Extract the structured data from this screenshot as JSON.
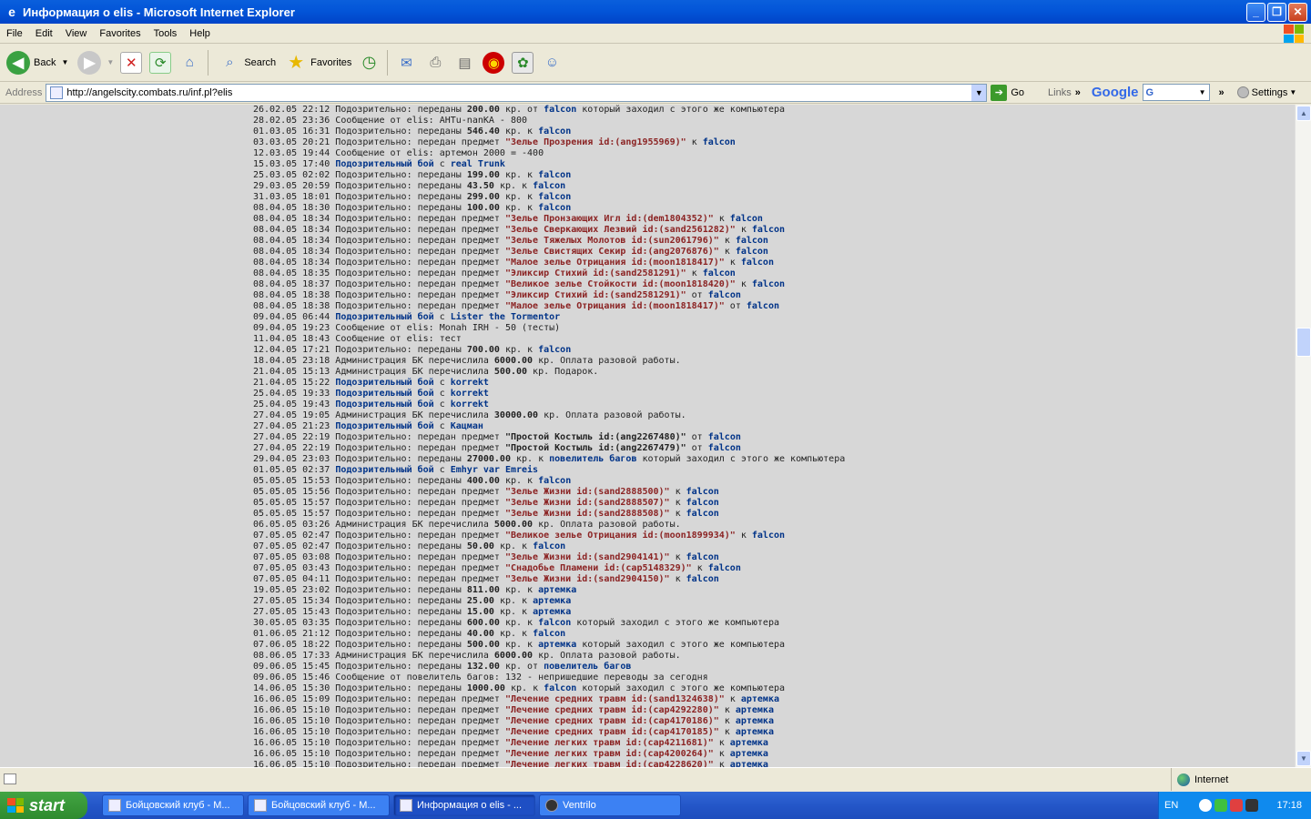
{
  "window": {
    "title": "Информация о elis - Microsoft Internet Explorer",
    "minimize": "_",
    "maximize": "❐",
    "close": "✕"
  },
  "menu": [
    "File",
    "Edit",
    "View",
    "Favorites",
    "Tools",
    "Help"
  ],
  "toolbar": {
    "back": "Back",
    "search": "Search",
    "favorites": "Favorites"
  },
  "address": {
    "label": "Address",
    "url": "http://angelscity.combats.ru/inf.pl?elis",
    "go": "Go",
    "links": "Links",
    "google": "Google",
    "google_select": "G",
    "settings": "Settings"
  },
  "log": [
    [
      [
        "26.02.05 22:12 Подозрительно: переданы ",
        ""
      ],
      [
        "200.00",
        "b"
      ],
      [
        " кр. от ",
        ""
      ],
      [
        "falcon",
        "n"
      ],
      [
        " который заходил с этого же компьютера",
        ""
      ]
    ],
    [
      [
        "28.02.05 23:36 Сообщение от elis: AHTu-nanKA - 800",
        ""
      ]
    ],
    [
      [
        "01.03.05 16:31 Подозрительно: переданы ",
        ""
      ],
      [
        "546.40",
        "b"
      ],
      [
        " кр. к ",
        ""
      ],
      [
        "falcon",
        "n"
      ]
    ],
    [
      [
        "03.03.05 20:21 Подозрительно: передан предмет ",
        ""
      ],
      [
        "\"Зелье Прозрения id:(ang1955969)\"",
        "i"
      ],
      [
        " к ",
        ""
      ],
      [
        "falcon",
        "n"
      ]
    ],
    [
      [
        "12.03.05 19:44 Сообщение от elis: артемон 2000 = -400",
        ""
      ]
    ],
    [
      [
        "15.03.05 17:40 ",
        ""
      ],
      [
        "Подозрительный бой",
        "n"
      ],
      [
        " с ",
        ""
      ],
      [
        "real Trunk",
        "n"
      ]
    ],
    [
      [
        "25.03.05 02:02 Подозрительно: переданы ",
        ""
      ],
      [
        "199.00",
        "b"
      ],
      [
        " кр. к ",
        ""
      ],
      [
        "falcon",
        "n"
      ]
    ],
    [
      [
        "29.03.05 20:59 Подозрительно: переданы ",
        ""
      ],
      [
        "43.50",
        "b"
      ],
      [
        " кр. к ",
        ""
      ],
      [
        "falcon",
        "n"
      ]
    ],
    [
      [
        "31.03.05 18:01 Подозрительно: переданы ",
        ""
      ],
      [
        "299.00",
        "b"
      ],
      [
        " кр. к ",
        ""
      ],
      [
        "falcon",
        "n"
      ]
    ],
    [
      [
        "08.04.05 18:30 Подозрительно: переданы ",
        ""
      ],
      [
        "100.00",
        "b"
      ],
      [
        " кр. к ",
        ""
      ],
      [
        "falcon",
        "n"
      ]
    ],
    [
      [
        "08.04.05 18:34 Подозрительно: передан предмет ",
        ""
      ],
      [
        "\"Зелье Пронзающих Игл id:(dem1804352)\"",
        "i"
      ],
      [
        " к ",
        ""
      ],
      [
        "falcon",
        "n"
      ]
    ],
    [
      [
        "08.04.05 18:34 Подозрительно: передан предмет ",
        ""
      ],
      [
        "\"Зелье Сверкающих Лезвий id:(sand2561282)\"",
        "i"
      ],
      [
        " к ",
        ""
      ],
      [
        "falcon",
        "n"
      ]
    ],
    [
      [
        "08.04.05 18:34 Подозрительно: передан предмет ",
        ""
      ],
      [
        "\"Зелье Тяжелых Молотов id:(sun2061796)\"",
        "i"
      ],
      [
        " к ",
        ""
      ],
      [
        "falcon",
        "n"
      ]
    ],
    [
      [
        "08.04.05 18:34 Подозрительно: передан предмет ",
        ""
      ],
      [
        "\"Зелье Свистящих Секир id:(ang2076876)\"",
        "i"
      ],
      [
        " к ",
        ""
      ],
      [
        "falcon",
        "n"
      ]
    ],
    [
      [
        "08.04.05 18:34 Подозрительно: передан предмет ",
        ""
      ],
      [
        "\"Малое зелье Отрицания id:(moon1818417)\"",
        "i"
      ],
      [
        " к ",
        ""
      ],
      [
        "falcon",
        "n"
      ]
    ],
    [
      [
        "08.04.05 18:35 Подозрительно: передан предмет ",
        ""
      ],
      [
        "\"Эликсир Стихий id:(sand2581291)\"",
        "i"
      ],
      [
        " к ",
        ""
      ],
      [
        "falcon",
        "n"
      ]
    ],
    [
      [
        "08.04.05 18:37 Подозрительно: передан предмет ",
        ""
      ],
      [
        "\"Великое зелье Стойкости id:(moon1818420)\"",
        "i"
      ],
      [
        " к ",
        ""
      ],
      [
        "falcon",
        "n"
      ]
    ],
    [
      [
        "08.04.05 18:38 Подозрительно: передан предмет ",
        ""
      ],
      [
        "\"Эликсир Стихий id:(sand2581291)\"",
        "i"
      ],
      [
        " от ",
        ""
      ],
      [
        "falcon",
        "n"
      ]
    ],
    [
      [
        "08.04.05 18:38 Подозрительно: передан предмет ",
        ""
      ],
      [
        "\"Малое зелье Отрицания id:(moon1818417)\"",
        "i"
      ],
      [
        " от ",
        ""
      ],
      [
        "falcon",
        "n"
      ]
    ],
    [
      [
        "09.04.05 06:44 ",
        ""
      ],
      [
        "Подозрительный бой",
        "n"
      ],
      [
        " с ",
        ""
      ],
      [
        "Lister the Tormentor",
        "n"
      ]
    ],
    [
      [
        "09.04.05 19:23 Сообщение от elis: Monah IRH - 50 (тесты)",
        ""
      ]
    ],
    [
      [
        "11.04.05 18:43 Сообщение от elis: тест",
        ""
      ]
    ],
    [
      [
        "12.04.05 17:21 Подозрительно: переданы ",
        ""
      ],
      [
        "700.00",
        "b"
      ],
      [
        " кр. к ",
        ""
      ],
      [
        "falcon",
        "n"
      ]
    ],
    [
      [
        "18.04.05 23:18 Администрация БК перечислила ",
        ""
      ],
      [
        "6000.00",
        "b"
      ],
      [
        " кр. Оплата разовой работы.",
        ""
      ]
    ],
    [
      [
        "21.04.05 15:13 Администрация БК перечислила ",
        ""
      ],
      [
        "500.00",
        "b"
      ],
      [
        " кр. Подарок.",
        ""
      ]
    ],
    [
      [
        "21.04.05 15:22 ",
        ""
      ],
      [
        "Подозрительный бой",
        "n"
      ],
      [
        " с ",
        ""
      ],
      [
        "korrekt",
        "n"
      ]
    ],
    [
      [
        "25.04.05 19:33 ",
        ""
      ],
      [
        "Подозрительный бой",
        "n"
      ],
      [
        " с ",
        ""
      ],
      [
        "korrekt",
        "n"
      ]
    ],
    [
      [
        "25.04.05 19:43 ",
        ""
      ],
      [
        "Подозрительный бой",
        "n"
      ],
      [
        " с ",
        ""
      ],
      [
        "korrekt",
        "n"
      ]
    ],
    [
      [
        "27.04.05 19:05 Администрация БК перечислила ",
        ""
      ],
      [
        "30000.00",
        "b"
      ],
      [
        " кр. Оплата разовой работы.",
        ""
      ]
    ],
    [
      [
        "27.04.05 21:23 ",
        ""
      ],
      [
        "Подозрительный бой",
        "n"
      ],
      [
        " с ",
        ""
      ],
      [
        "Кацман",
        "n"
      ]
    ],
    [
      [
        "27.04.05 22:19 Подозрительно: передан предмет ",
        ""
      ],
      [
        "\"Простой Костыль id:(ang2267480)\"",
        "b"
      ],
      [
        " от ",
        ""
      ],
      [
        "falcon",
        "n"
      ]
    ],
    [
      [
        "27.04.05 22:19 Подозрительно: передан предмет ",
        ""
      ],
      [
        "\"Простой Костыль id:(ang2267479)\"",
        "b"
      ],
      [
        " от ",
        ""
      ],
      [
        "falcon",
        "n"
      ]
    ],
    [
      [
        "29.04.05 23:03 Подозрительно: переданы ",
        ""
      ],
      [
        "27000.00",
        "b"
      ],
      [
        " кр. к ",
        ""
      ],
      [
        "повелитель багов",
        "n"
      ],
      [
        " который заходил с этого же компьютера",
        ""
      ]
    ],
    [
      [
        "01.05.05 02:37 ",
        ""
      ],
      [
        "Подозрительный бой",
        "n"
      ],
      [
        " с ",
        ""
      ],
      [
        "Emhyr var Emreis",
        "n"
      ]
    ],
    [
      [
        "05.05.05 15:53 Подозрительно: переданы ",
        ""
      ],
      [
        "400.00",
        "b"
      ],
      [
        " кр. к ",
        ""
      ],
      [
        "falcon",
        "n"
      ]
    ],
    [
      [
        "05.05.05 15:56 Подозрительно: передан предмет ",
        ""
      ],
      [
        "\"Зелье Жизни id:(sand2888500)\"",
        "i"
      ],
      [
        " к ",
        ""
      ],
      [
        "falcon",
        "n"
      ]
    ],
    [
      [
        "05.05.05 15:57 Подозрительно: передан предмет ",
        ""
      ],
      [
        "\"Зелье Жизни id:(sand2888507)\"",
        "i"
      ],
      [
        " к ",
        ""
      ],
      [
        "falcon",
        "n"
      ]
    ],
    [
      [
        "05.05.05 15:57 Подозрительно: передан предмет ",
        ""
      ],
      [
        "\"Зелье Жизни id:(sand2888508)\"",
        "i"
      ],
      [
        " к ",
        ""
      ],
      [
        "falcon",
        "n"
      ]
    ],
    [
      [
        "06.05.05 03:26 Администрация БК перечислила ",
        ""
      ],
      [
        "5000.00",
        "b"
      ],
      [
        " кр. Оплата разовой работы.",
        ""
      ]
    ],
    [
      [
        "07.05.05 02:47 Подозрительно: передан предмет ",
        ""
      ],
      [
        "\"Великое зелье Отрицания id:(moon1899934)\"",
        "i"
      ],
      [
        " к ",
        ""
      ],
      [
        "falcon",
        "n"
      ]
    ],
    [
      [
        "07.05.05 02:47 Подозрительно: переданы ",
        ""
      ],
      [
        "50.00",
        "b"
      ],
      [
        " кр. к ",
        ""
      ],
      [
        "falcon",
        "n"
      ]
    ],
    [
      [
        "07.05.05 03:08 Подозрительно: передан предмет ",
        ""
      ],
      [
        "\"Зелье Жизни id:(sand2904141)\"",
        "i"
      ],
      [
        " к ",
        ""
      ],
      [
        "falcon",
        "n"
      ]
    ],
    [
      [
        "07.05.05 03:43 Подозрительно: передан предмет ",
        ""
      ],
      [
        "\"Снадобье Пламени id:(cap5148329)\"",
        "i"
      ],
      [
        " к ",
        ""
      ],
      [
        "falcon",
        "n"
      ]
    ],
    [
      [
        "07.05.05 04:11 Подозрительно: передан предмет ",
        ""
      ],
      [
        "\"Зелье Жизни id:(sand2904150)\"",
        "i"
      ],
      [
        " к ",
        ""
      ],
      [
        "falcon",
        "n"
      ]
    ],
    [
      [
        "19.05.05 23:02 Подозрительно: переданы ",
        ""
      ],
      [
        "811.00",
        "b"
      ],
      [
        " кр. к ",
        ""
      ],
      [
        "артемка",
        "n"
      ]
    ],
    [
      [
        "27.05.05 15:34 Подозрительно: переданы ",
        ""
      ],
      [
        "25.00",
        "b"
      ],
      [
        " кр. к ",
        ""
      ],
      [
        "артемка",
        "n"
      ]
    ],
    [
      [
        "27.05.05 15:43 Подозрительно: переданы ",
        ""
      ],
      [
        "15.00",
        "b"
      ],
      [
        " кр. к ",
        ""
      ],
      [
        "артемка",
        "n"
      ]
    ],
    [
      [
        "30.05.05 03:35 Подозрительно: переданы ",
        ""
      ],
      [
        "600.00",
        "b"
      ],
      [
        " кр. к ",
        ""
      ],
      [
        "falcon",
        "n"
      ],
      [
        " который заходил с этого же компьютера",
        ""
      ]
    ],
    [
      [
        "01.06.05 21:12 Подозрительно: переданы ",
        ""
      ],
      [
        "40.00",
        "b"
      ],
      [
        " кр. к ",
        ""
      ],
      [
        "falcon",
        "n"
      ]
    ],
    [
      [
        "07.06.05 18:22 Подозрительно: переданы ",
        ""
      ],
      [
        "500.00",
        "b"
      ],
      [
        " кр. к ",
        ""
      ],
      [
        "артемка",
        "n"
      ],
      [
        " который заходил с этого же компьютера",
        ""
      ]
    ],
    [
      [
        "08.06.05 17:33 Администрация БК перечислила ",
        ""
      ],
      [
        "6000.00",
        "b"
      ],
      [
        " кр. Оплата разовой работы.",
        ""
      ]
    ],
    [
      [
        "09.06.05 15:45 Подозрительно: переданы ",
        ""
      ],
      [
        "132.00",
        "b"
      ],
      [
        " кр. от ",
        ""
      ],
      [
        "повелитель багов",
        "n"
      ]
    ],
    [
      [
        "09.06.05 15:46 Сообщение от повелитель багов: 132 - непришедшие переводы за сегодня",
        ""
      ]
    ],
    [
      [
        "14.06.05 15:30 Подозрительно: переданы ",
        ""
      ],
      [
        "1000.00",
        "b"
      ],
      [
        " кр. к ",
        ""
      ],
      [
        "falcon",
        "n"
      ],
      [
        " который заходил с этого же компьютера",
        ""
      ]
    ],
    [
      [
        "16.06.05 15:09 Подозрительно: передан предмет ",
        ""
      ],
      [
        "\"Лечение средних травм id:(sand1324638)\"",
        "i"
      ],
      [
        " к ",
        ""
      ],
      [
        "артемка",
        "n"
      ]
    ],
    [
      [
        "16.06.05 15:10 Подозрительно: передан предмет ",
        ""
      ],
      [
        "\"Лечение средних травм id:(cap4292280)\"",
        "i"
      ],
      [
        " к ",
        ""
      ],
      [
        "артемка",
        "n"
      ]
    ],
    [
      [
        "16.06.05 15:10 Подозрительно: передан предмет ",
        ""
      ],
      [
        "\"Лечение средних травм id:(cap4170186)\"",
        "i"
      ],
      [
        " к ",
        ""
      ],
      [
        "артемка",
        "n"
      ]
    ],
    [
      [
        "16.06.05 15:10 Подозрительно: передан предмет ",
        ""
      ],
      [
        "\"Лечение средних травм id:(cap4170185)\"",
        "i"
      ],
      [
        " к ",
        ""
      ],
      [
        "артемка",
        "n"
      ]
    ],
    [
      [
        "16.06.05 15:10 Подозрительно: передан предмет ",
        ""
      ],
      [
        "\"Лечение легких травм id:(cap4211681)\"",
        "i"
      ],
      [
        " к ",
        ""
      ],
      [
        "артемка",
        "n"
      ]
    ],
    [
      [
        "16.06.05 15:10 Подозрительно: передан предмет ",
        ""
      ],
      [
        "\"Лечение легких травм id:(cap4200264)\"",
        "i"
      ],
      [
        " к ",
        ""
      ],
      [
        "артемка",
        "n"
      ]
    ],
    [
      [
        "16.06.05 15:10 Подозрительно: передан предмет ",
        ""
      ],
      [
        "\"Лечение легких травм id:(cap4228620)\"",
        "i"
      ],
      [
        " к ",
        ""
      ],
      [
        "артемка",
        "n"
      ]
    ]
  ],
  "status": {
    "zone": "Internet"
  },
  "taskbar": {
    "start": "start",
    "tasks": [
      "Бойцовский клуб - M...",
      "Бойцовский клуб - M...",
      "Информация о elis - ...",
      "Ventrilo"
    ],
    "lang": "EN",
    "clock": "17:18"
  },
  "colors": {
    "item": "#8b2323",
    "nick": "#003388",
    "page_bg": "#d7d7d7",
    "titlebar": "#0355d8"
  }
}
